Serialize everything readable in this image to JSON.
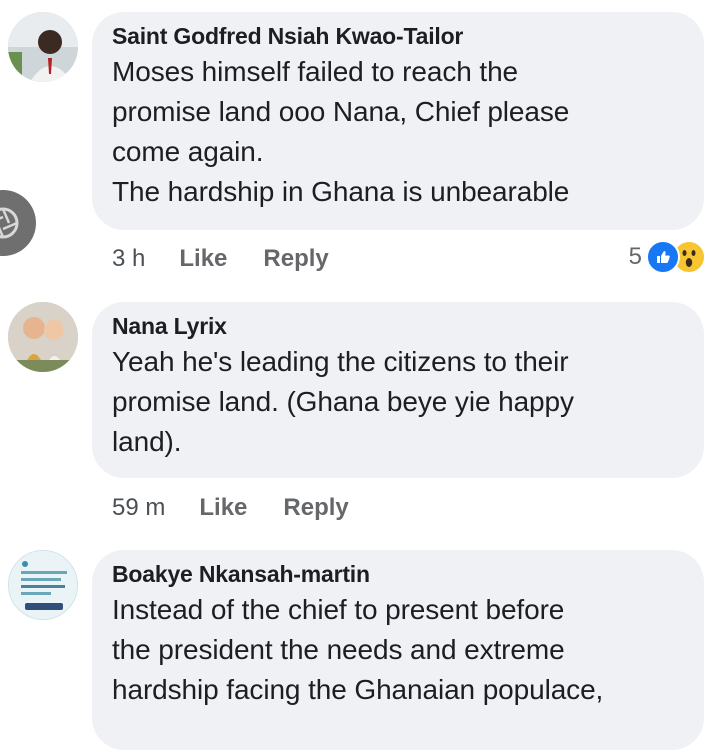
{
  "comments": [
    {
      "author": "Saint Godfred Nsiah Kwao-Tailor",
      "text": "Moses himself failed to reach the\npromise land ooo Nana, Chief please\ncome again.\nThe hardship in Ghana  is unbearable",
      "time": "3 h",
      "like_label": "Like",
      "reply_label": "Reply",
      "reaction_count": "5",
      "reactions": [
        "like-icon",
        "wow-icon"
      ]
    },
    {
      "author": "Nana Lyrix",
      "text": "Yeah he's leading the citizens to their\npromise land. (Ghana beye yie happy\nland).",
      "time": "59 m",
      "like_label": "Like",
      "reply_label": "Reply"
    },
    {
      "author": "Boakye Nkansah-martin",
      "text": "Instead of the chief to present before\nthe president the needs and extreme\nhardship facing the Ghanaian populace,"
    }
  ],
  "colors": {
    "bubble": "#eff1f4",
    "meta_text": "#65676b",
    "like_blue": "#1877f2",
    "wow_yellow": "#f7c531"
  }
}
